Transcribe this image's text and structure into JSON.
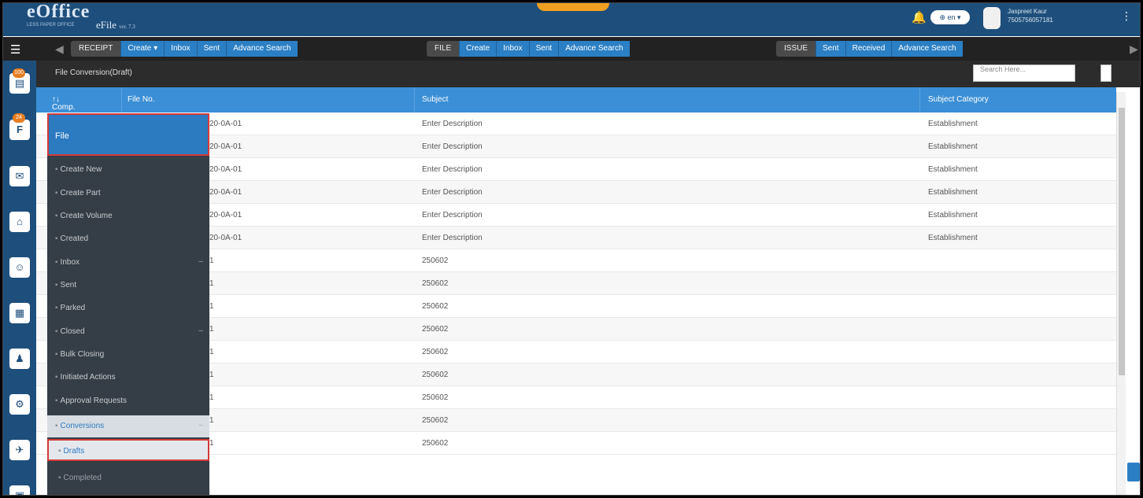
{
  "header": {
    "logo": "eOffice",
    "tagline": "LESS PAPER OFFICE",
    "product": "eFile",
    "version": "ver. 7.3",
    "language": "en",
    "user_name": "Jaspreet Kaur",
    "user_id": "7505756057181"
  },
  "toolbar": {
    "receipt": {
      "label": "RECEIPT",
      "items": [
        "Create",
        "Inbox",
        "Sent",
        "Advance Search"
      ]
    },
    "file": {
      "label": "FILE",
      "items": [
        "Create",
        "Inbox",
        "Sent",
        "Advance Search"
      ]
    },
    "issue": {
      "label": "ISSUE",
      "items": [
        "Sent",
        "Received",
        "Advance Search"
      ]
    }
  },
  "rail_badges": [
    "100",
    "24"
  ],
  "page": {
    "title": "File Conversion(Draft)",
    "search_placeholder": "Search Here..."
  },
  "grid": {
    "columns": [
      "Comp. No.",
      "File No.",
      "Subject",
      "Subject Category"
    ],
    "rows": [
      {
        "file_no": "20-0A-01",
        "subject": "Enter Description",
        "category": "Establishment"
      },
      {
        "file_no": "20-0A-01",
        "subject": "Enter Description",
        "category": "Establishment"
      },
      {
        "file_no": "20-0A-01",
        "subject": "Enter Description",
        "category": "Establishment"
      },
      {
        "file_no": "20-0A-01",
        "subject": "Enter Description",
        "category": "Establishment"
      },
      {
        "file_no": "20-0A-01",
        "subject": "Enter Description",
        "category": "Establishment"
      },
      {
        "file_no": "20-0A-01",
        "subject": "Enter Description",
        "category": "Establishment"
      },
      {
        "file_no": "1",
        "subject": "250602",
        "category": ""
      },
      {
        "file_no": "1",
        "subject": "250602",
        "category": ""
      },
      {
        "file_no": "1",
        "subject": "250602",
        "category": ""
      },
      {
        "file_no": "1",
        "subject": "250602",
        "category": ""
      },
      {
        "file_no": "1",
        "subject": "250602",
        "category": ""
      },
      {
        "file_no": "1",
        "subject": "250602",
        "category": ""
      },
      {
        "file_no": "1",
        "subject": "250602",
        "category": ""
      },
      {
        "file_no": "1",
        "subject": "250602",
        "category": ""
      },
      {
        "file_no": "1",
        "subject": "250602",
        "category": ""
      }
    ]
  },
  "menu": {
    "header": "File",
    "items": [
      {
        "label": "Create New"
      },
      {
        "label": "Create Part"
      },
      {
        "label": "Create Volume"
      },
      {
        "label": "Created"
      },
      {
        "label": "Inbox",
        "expand": "–"
      },
      {
        "label": "Sent"
      },
      {
        "label": "Parked"
      },
      {
        "label": "Closed",
        "expand": "–"
      },
      {
        "label": "Bulk Closing"
      },
      {
        "label": "Initiated Actions"
      },
      {
        "label": "Approval Requests"
      },
      {
        "label": "Conversions",
        "expand": "–"
      },
      {
        "label": "Drafts"
      },
      {
        "label": "Completed"
      }
    ]
  }
}
